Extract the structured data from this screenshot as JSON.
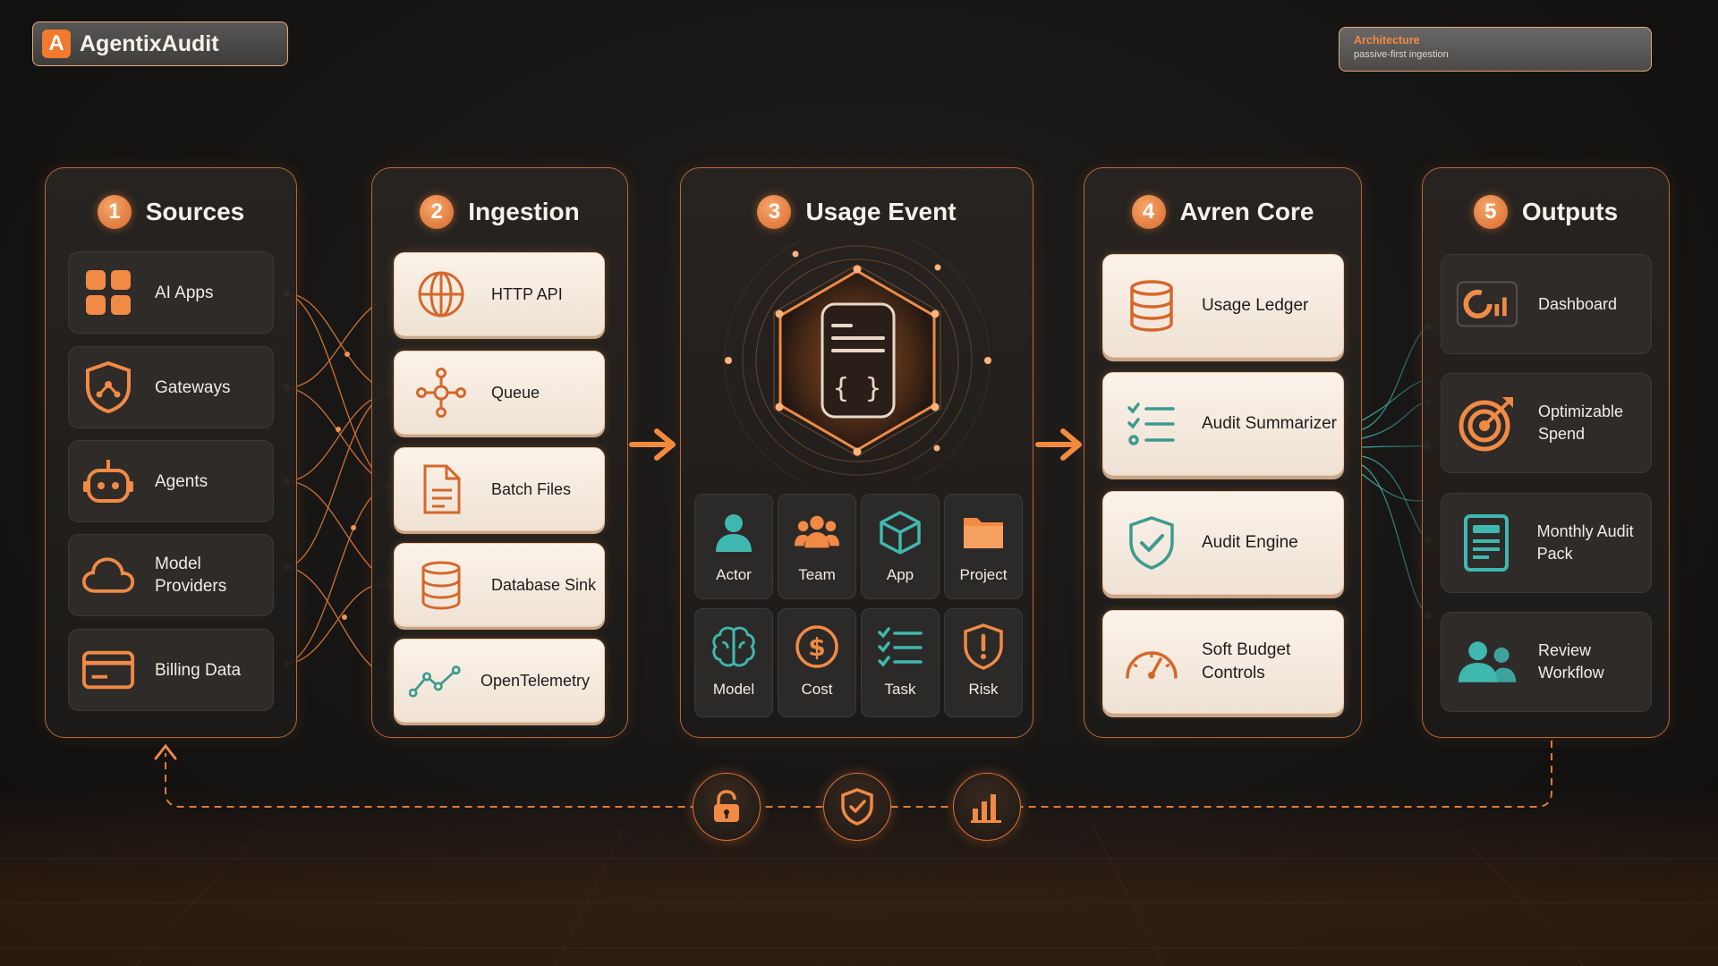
{
  "brand": {
    "logo_letter": "A",
    "name": "AgentixAudit"
  },
  "badge": {
    "title": "Architecture",
    "subtitle": "passive-first ingestion"
  },
  "colors": {
    "accent": "#f27a2e",
    "teal": "#3fb8b0",
    "card_light": "#fbf2e9",
    "card_dark": "#2e2b29"
  },
  "steps": [
    {
      "number": "1",
      "title": "Sources"
    },
    {
      "number": "2",
      "title": "Ingestion"
    },
    {
      "number": "3",
      "title": "Usage Event"
    },
    {
      "number": "4",
      "title": "Avren Core"
    },
    {
      "number": "5",
      "title": "Outputs"
    }
  ],
  "sources": [
    {
      "label": "AI Apps",
      "icon": "apps-grid-icon"
    },
    {
      "label": "Gateways",
      "icon": "shield-gateway-icon"
    },
    {
      "label": "Agents",
      "icon": "robot-icon"
    },
    {
      "label": "Model Providers",
      "icon": "cloud-icon"
    },
    {
      "label": "Billing Data",
      "icon": "credit-card-icon"
    }
  ],
  "ingestion": [
    {
      "label": "HTTP API",
      "icon": "globe-icon"
    },
    {
      "label": "Queue",
      "icon": "queue-nodes-icon"
    },
    {
      "label": "Batch Files",
      "icon": "file-icon"
    },
    {
      "label": "Database Sink",
      "icon": "database-icon"
    },
    {
      "label": "OpenTelemetry",
      "icon": "telemetry-line-icon"
    }
  ],
  "usage_event": {
    "center_icon": "json-document-icon",
    "attributes": [
      {
        "label": "Actor",
        "icon": "person-icon"
      },
      {
        "label": "Team",
        "icon": "team-icon"
      },
      {
        "label": "App",
        "icon": "cube-icon"
      },
      {
        "label": "Project",
        "icon": "folder-icon"
      },
      {
        "label": "Model",
        "icon": "brain-icon"
      },
      {
        "label": "Cost",
        "icon": "dollar-icon"
      },
      {
        "label": "Task",
        "icon": "checklist-icon"
      },
      {
        "label": "Risk",
        "icon": "warning-shield-icon"
      }
    ]
  },
  "core": [
    {
      "label": "Usage Ledger",
      "icon": "database-icon"
    },
    {
      "label": "Audit Summarizer",
      "icon": "checklist-icon"
    },
    {
      "label": "Audit Engine",
      "icon": "check-shield-icon"
    },
    {
      "label": "Soft Budget Controls",
      "icon": "gauge-icon"
    }
  ],
  "outputs": [
    {
      "label": "Dashboard",
      "icon": "dashboard-icon"
    },
    {
      "label": "Optimizable Spend",
      "icon": "target-icon"
    },
    {
      "label": "Monthly Audit Pack",
      "icon": "report-icon"
    },
    {
      "label": "Review Workflow",
      "icon": "users-icon"
    }
  ],
  "feedback_loop": [
    {
      "icon": "lock-icon"
    },
    {
      "icon": "shield-check-icon"
    },
    {
      "icon": "bar-chart-icon"
    }
  ]
}
